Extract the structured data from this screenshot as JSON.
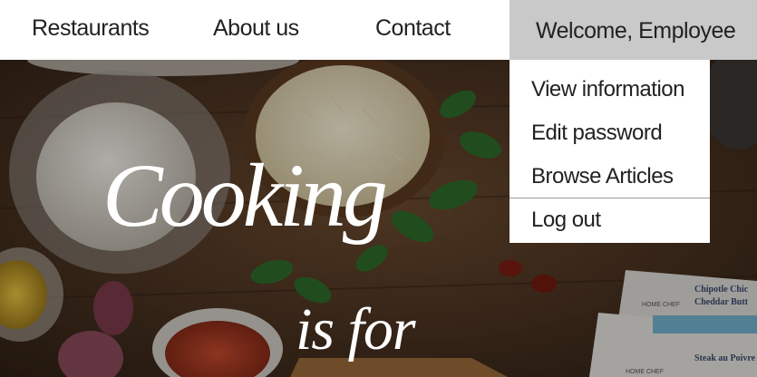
{
  "nav": {
    "items": [
      {
        "label": "Restaurants"
      },
      {
        "label": "About us"
      },
      {
        "label": "Contact"
      }
    ],
    "user_label": "Welcome, Employee"
  },
  "user_menu": {
    "items": [
      {
        "label": "View information"
      },
      {
        "label": "Edit password"
      },
      {
        "label": "Browse Articles"
      },
      {
        "label": "Log out"
      }
    ]
  },
  "hero": {
    "title": "Cooking",
    "subtitle": "is for"
  },
  "cards": [
    {
      "brand": "HOME CHEF",
      "title": "Chipotle Chic",
      "title2": "Cheddar Butt"
    },
    {
      "brand": "HOME CHEF",
      "title": "Steak au Poivre"
    }
  ],
  "colors": {
    "nav_bg": "#ffffff",
    "user_menu_bg": "#c9c9c9",
    "text": "#222222",
    "hero_text": "#ffffff"
  }
}
